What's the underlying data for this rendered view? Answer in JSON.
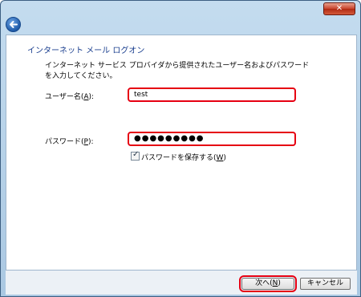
{
  "window": {
    "close_label": "✕"
  },
  "page": {
    "title": "インターネット メール ログオン",
    "instructions": "インターネット サービス プロバイダから提供されたユーザー名およびパスワードを入力してください。"
  },
  "username": {
    "label": "ユーザー名(",
    "accel": "A",
    "label_end": "):",
    "value": "test"
  },
  "password": {
    "label": "パスワード(",
    "accel": "P",
    "label_end": "):",
    "value": "●●●●●●●●●"
  },
  "remember": {
    "label": "パスワードを保存する(",
    "accel": "W",
    "label_end": ")",
    "checked": true
  },
  "buttons": {
    "next": {
      "label": "次へ(",
      "accel": "N",
      "label_end": ")"
    },
    "cancel": {
      "label": "キャンセル"
    }
  },
  "colors": {
    "highlight": "#e60012",
    "title": "#1b3f8f"
  },
  "icons": {
    "back": "back-arrow-icon",
    "close": "close-icon",
    "check": "checkmark-icon"
  }
}
